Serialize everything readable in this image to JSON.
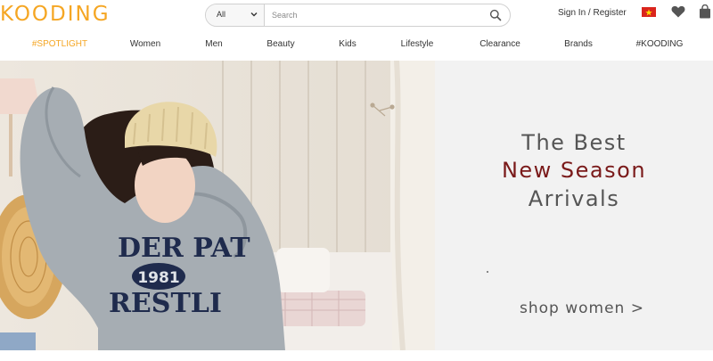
{
  "header": {
    "logo": "KOODING",
    "search": {
      "category": "All",
      "placeholder": "Search"
    },
    "signin": "Sign In / Register",
    "colors": {
      "brand": "#f5a623",
      "flag": "#da251d"
    },
    "icons": [
      "vietnam-flag-icon",
      "heart-icon",
      "shopping-bag-icon",
      "search-icon",
      "chevron-down-icon"
    ]
  },
  "nav": {
    "items": [
      "#SPOTLIGHT",
      "Women",
      "Men",
      "Beauty",
      "Kids",
      "Lifestyle",
      "Clearance",
      "Brands",
      "#KOODING"
    ]
  },
  "hero": {
    "line1": "The Best",
    "line2": "New Season",
    "line3": "Arrivals",
    "cta": "shop women >",
    "sweatshirt_text": {
      "top": "DER PAT",
      "badge": "1981",
      "bottom": "RESTLI"
    },
    "colors": {
      "panel_bg": "#f2f2f2",
      "highlight": "#7a1a1a"
    }
  }
}
